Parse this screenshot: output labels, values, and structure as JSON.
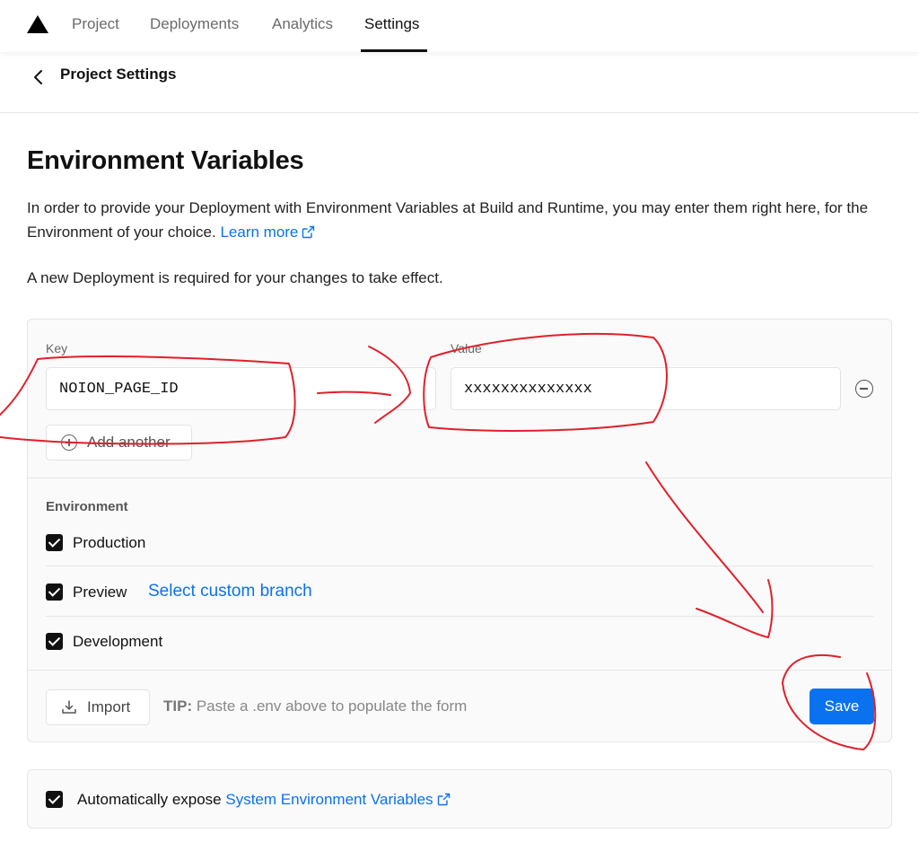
{
  "nav": {
    "tabs": [
      {
        "label": "Project"
      },
      {
        "label": "Deployments"
      },
      {
        "label": "Analytics"
      },
      {
        "label": "Settings",
        "active": true
      }
    ]
  },
  "subheader": {
    "title": "Project Settings"
  },
  "section": {
    "title": "Environment Variables",
    "description": "In order to provide your Deployment with Environment Variables at Build and Runtime, you may enter them right here, for the Environment of your choice.",
    "learn_more": "Learn more",
    "note": "A new Deployment is required for your changes to take effect."
  },
  "form": {
    "key_label": "Key",
    "value_label": "Value",
    "key_value": "NOION_PAGE_ID",
    "value_value": "xxxxxxxxxxxxxx",
    "add_another": "Add another",
    "environment_heading": "Environment",
    "environments": [
      {
        "label": "Production",
        "checked": true
      },
      {
        "label": "Preview",
        "checked": true
      },
      {
        "label": "Development",
        "checked": true
      }
    ],
    "custom_branch": "Select custom branch",
    "import_label": "Import",
    "tip_prefix": "TIP:",
    "tip_text": "Paste a .env above to populate the form",
    "save_label": "Save"
  },
  "system_vars": {
    "prefix": "Automatically expose",
    "link": "System Environment Variables",
    "checked": true
  },
  "colors": {
    "accent": "#0a72ef",
    "annotation": "#e0202a"
  },
  "icons": [
    "vercel-logo-icon",
    "chevron-left-icon",
    "external-link-icon",
    "minus-circle-icon",
    "plus-circle-icon",
    "import-icon",
    "check-icon"
  ]
}
